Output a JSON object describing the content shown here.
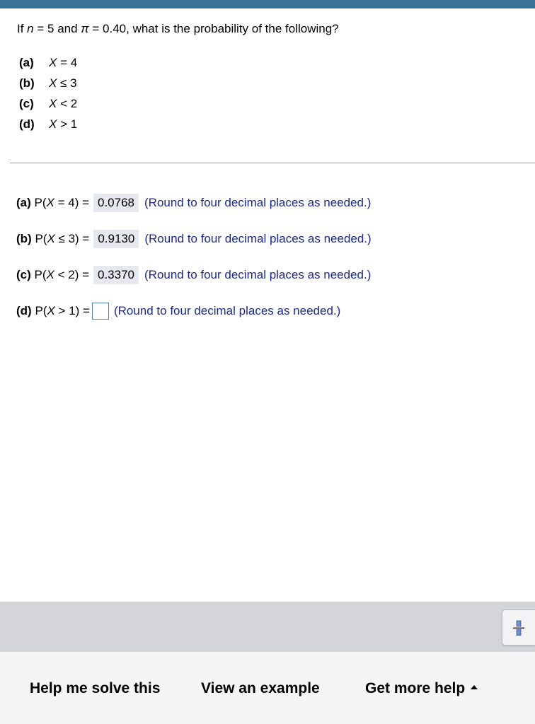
{
  "question": {
    "lead": "If ",
    "n_var": "n",
    "n_eq": " = 5 and ",
    "pi_var": "π",
    "pi_eq": " = 0.40, what is the probability of the following?"
  },
  "parts": [
    {
      "letter": "(a)",
      "var": "X",
      "rel": " = 4"
    },
    {
      "letter": "(b)",
      "var": "X",
      "rel": " ≤ 3"
    },
    {
      "letter": "(c)",
      "var": "X",
      "rel": " < 2"
    },
    {
      "letter": "(d)",
      "var": "X",
      "rel": " > 1"
    }
  ],
  "answers": [
    {
      "letter": "(a)",
      "pre": " P(",
      "var": "X",
      "post": " = 4) =",
      "value": "0.0768",
      "hint": "(Round to four decimal places as needed.)"
    },
    {
      "letter": "(b)",
      "pre": " P(",
      "var": "X",
      "post": " ≤ 3) =",
      "value": "0.9130",
      "hint": "(Round to four decimal places as needed.)"
    },
    {
      "letter": "(c)",
      "pre": " P(",
      "var": "X",
      "post": " < 2) =",
      "value": "0.3370",
      "hint": "(Round to four decimal places as needed.)"
    },
    {
      "letter": "(d)",
      "pre": " P(",
      "var": "X",
      "post": " > 1) =",
      "value": "",
      "hint": "(Round to four decimal places as needed.)"
    }
  ],
  "footer": {
    "help": "Help me solve this",
    "example": "View an example",
    "more": "Get more help"
  },
  "colors": {
    "topbar": "#3a7396",
    "hint_text": "#1a2a8a",
    "answer_bg": "#e5e8ee",
    "input_border": "#4f7fc0"
  },
  "icons": {
    "tool": "fraction-icon",
    "caret": "caret-up-icon"
  }
}
